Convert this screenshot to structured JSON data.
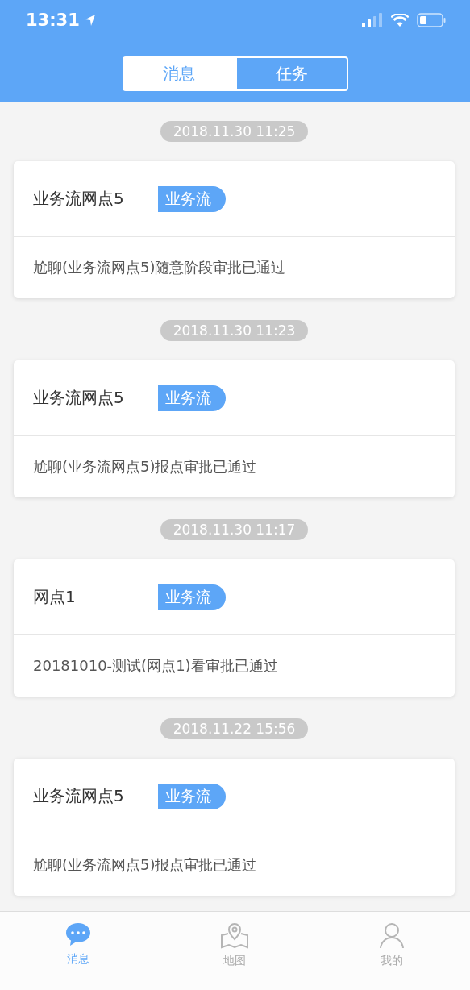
{
  "status_bar": {
    "time": "13:31"
  },
  "segments": [
    {
      "label": "消息",
      "selected": true
    },
    {
      "label": "任务",
      "selected": false
    }
  ],
  "messages": [
    {
      "date": "2018.11.30 11:25",
      "title": "业务流网点5",
      "tag": "业务流",
      "body": "尬聊(业务流网点5)随意阶段审批已通过"
    },
    {
      "date": "2018.11.30 11:23",
      "title": "业务流网点5",
      "tag": "业务流",
      "body": "尬聊(业务流网点5)报点审批已通过"
    },
    {
      "date": "2018.11.30 11:17",
      "title": "网点1",
      "tag": "业务流",
      "body": "20181010-测试(网点1)看审批已通过"
    },
    {
      "date": "2018.11.22 15:56",
      "title": "业务流网点5",
      "tag": "业务流",
      "body": "尬聊(业务流网点5)报点审批已通过"
    }
  ],
  "tab_bar": [
    {
      "kind": "chat",
      "label": "消息",
      "selected": true
    },
    {
      "kind": "map",
      "label": "地图",
      "selected": false
    },
    {
      "kind": "person",
      "label": "我的",
      "selected": false
    }
  ]
}
